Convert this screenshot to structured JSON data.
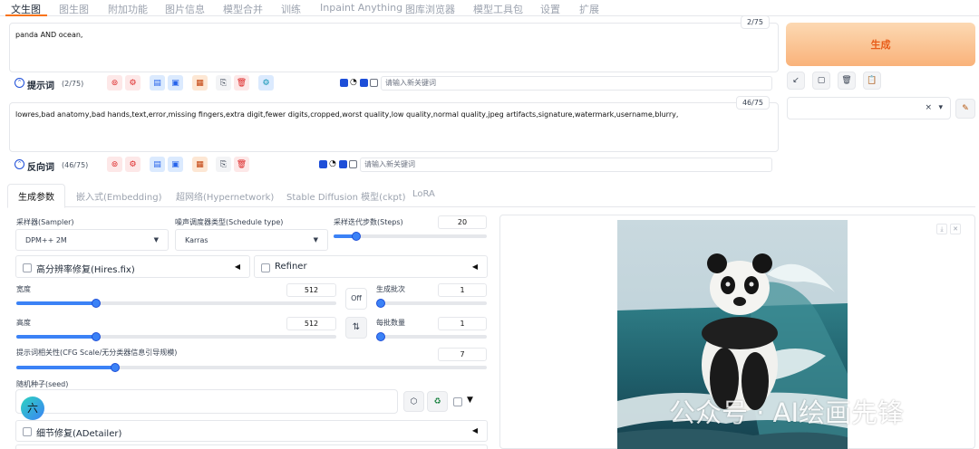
{
  "nav": {
    "tabs": [
      "文生图",
      "图生图",
      "附加功能",
      "图片信息",
      "模型合并",
      "训练",
      "Inpaint Anything",
      "图库浏览器",
      "模型工具包",
      "设置",
      "扩展"
    ]
  },
  "prompt": {
    "text": "panda AND ocean,",
    "counter": "2/75",
    "label": "提示词",
    "count": "(2/75)",
    "keyword_placeholder": "请输入新关键词"
  },
  "negative": {
    "text": "lowres,bad anatomy,bad hands,text,error,missing fingers,extra digit,fewer digits,cropped,worst quality,low quality,normal quality,jpeg artifacts,signature,watermark,username,blurry,",
    "counter": "46/75",
    "label": "反向词",
    "count": "(46/75)",
    "keyword_placeholder": "请输入新关键词"
  },
  "right": {
    "generate": "生成",
    "style_clear": "×",
    "style_caret": "▾"
  },
  "subtabs": [
    "生成参数",
    "嵌入式(Embedding)",
    "超网络(Hypernetwork)",
    "Stable Diffusion 模型(ckpt)",
    "LoRA"
  ],
  "params": {
    "sampler_label": "采样器(Sampler)",
    "sampler_value": "DPM++ 2M",
    "schedule_label": "噪声调度器类型(Schedule type)",
    "schedule_value": "Karras",
    "steps_label": "采样迭代步数(Steps)",
    "steps_value": "20",
    "steps_fraction": 0.15,
    "hires_label": "高分辨率修复(Hires.fix)",
    "refiner_label": "Refiner",
    "width_label": "宽度",
    "width_value": "512",
    "width_fraction": 0.25,
    "height_label": "高度",
    "height_value": "512",
    "height_fraction": 0.25,
    "swap_label": "Off",
    "batch_count_label": "生成批次",
    "batch_count_value": "1",
    "batch_count_fraction": 0.0,
    "batch_size_label": "每批数量",
    "batch_size_value": "1",
    "batch_size_fraction": 0.0,
    "cfg_label": "提示词相关性(CFG Scale/无分类器信息引导规模)",
    "cfg_value": "7",
    "cfg_fraction": 0.21,
    "seed_label": "随机种子(seed)",
    "seed_badge": "六",
    "adetailer_label": "细节修复(ADetailer)"
  },
  "watermark": "公众号 · AI绘画先锋",
  "colors": {
    "accent": "#f97316",
    "primary": "#3b82f6"
  }
}
